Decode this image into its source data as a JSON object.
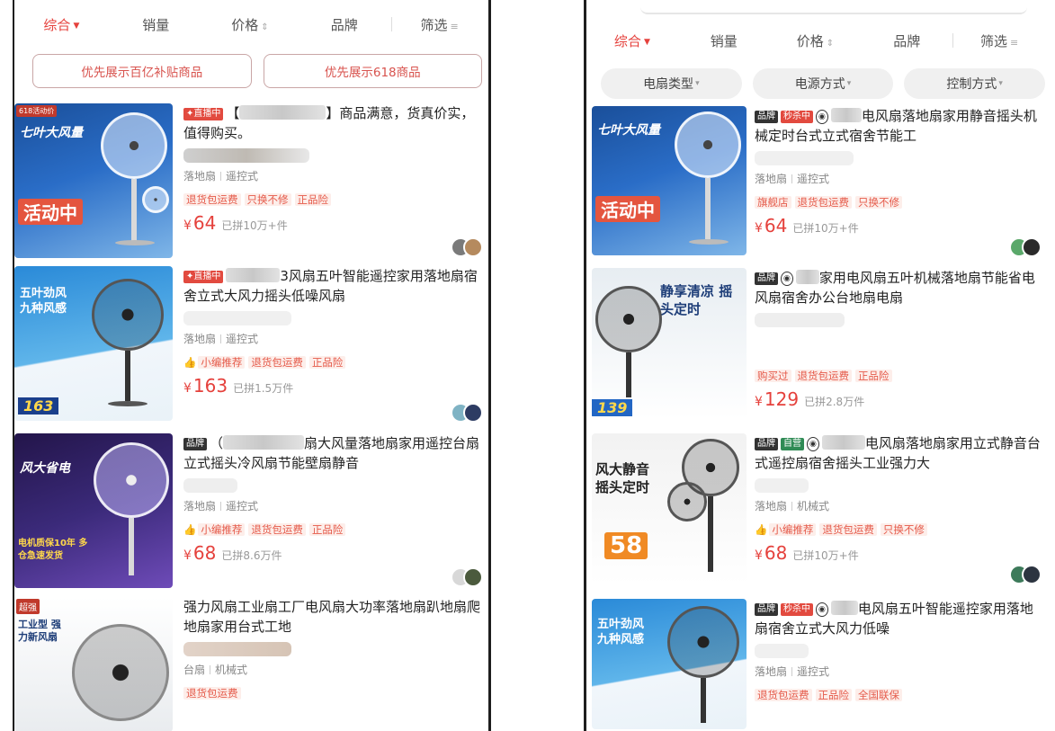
{
  "left": {
    "sort_tabs": [
      {
        "label": "综合",
        "active": true,
        "suffix": "▼"
      },
      {
        "label": "销量",
        "active": false,
        "suffix": ""
      },
      {
        "label": "价格",
        "active": false,
        "suffix": "⇕"
      },
      {
        "label": "品牌",
        "active": false,
        "suffix": ""
      },
      {
        "label": "筛选",
        "active": false,
        "suffix": "≡"
      }
    ],
    "pref_buttons": [
      "优先展示百亿补贴商品",
      "优先展示618商品"
    ],
    "products": [
      {
        "tags": [
          {
            "text": "✦直播中",
            "kind": "red"
          }
        ],
        "title_pre": "【",
        "title_post": "】商品满意，货真价实，值得购买。",
        "specs": [
          "落地扇",
          "遥控式"
        ],
        "services": [
          "退货包运费",
          "只换不修",
          "正品险"
        ],
        "price": "64",
        "sold": "已拼10万+件",
        "image_text": {
          "banner": "七叶大风量",
          "promo": "活动中",
          "corner": "618活动价"
        },
        "avatar_colors": [
          "#7a7a7a",
          "#b58a5e"
        ]
      },
      {
        "tags": [
          {
            "text": "✦直播中",
            "kind": "red"
          }
        ],
        "title_pre": "",
        "title_post": "3风扇五叶智能遥控家用落地扇宿舍立式大风力摇头低噪风扇",
        "specs": [
          "落地扇",
          "遥控式"
        ],
        "services": [
          "小编推荐",
          "退货包运费",
          "正品险"
        ],
        "price": "163",
        "sold": "已拼1.5万件",
        "image_text": {
          "banner": "五叶劲风 九种风感",
          "promo": "163"
        },
        "avatar_colors": [
          "#7fb3c4",
          "#2d3c63"
        ]
      },
      {
        "tags": [
          {
            "text": "品牌",
            "kind": "dark"
          }
        ],
        "title_pre": "（",
        "title_post": "扇大风量落地扇家用遥控台扇立式摇头冷风扇节能壁扇静音",
        "specs": [
          "落地扇",
          "遥控式"
        ],
        "services": [
          "小编推荐",
          "退货包运费",
          "正品险"
        ],
        "price": "68",
        "sold": "已拼8.6万件",
        "image_text": {
          "banner": "风大省电",
          "promo": "电机质保10年 多仓急速发货"
        },
        "avatar_colors": [
          "#d8d8d8",
          "#4b5a3d"
        ]
      },
      {
        "tags": [],
        "title_pre": "",
        "title_post": "强力风扇工业扇工厂电风扇大功率落地扇趴地扇爬地扇家用台式工地",
        "specs": [
          "台扇",
          "机械式"
        ],
        "services": [
          "退货包运费"
        ],
        "price": "",
        "sold": "",
        "image_text": {
          "banner": "工业型 强力新风扇",
          "promo": "超强"
        },
        "avatar_colors": []
      }
    ]
  },
  "right": {
    "sort_tabs": [
      {
        "label": "综合",
        "active": true,
        "suffix": "▼"
      },
      {
        "label": "销量",
        "active": false,
        "suffix": ""
      },
      {
        "label": "价格",
        "active": false,
        "suffix": "⇕"
      },
      {
        "label": "品牌",
        "active": false,
        "suffix": ""
      },
      {
        "label": "筛选",
        "active": false,
        "suffix": "≡"
      }
    ],
    "chips": [
      "电扇类型",
      "电源方式",
      "控制方式"
    ],
    "products": [
      {
        "tags": [
          {
            "text": "品牌",
            "kind": "dark"
          },
          {
            "text": "秒杀中",
            "kind": "red"
          },
          {
            "text": "◉",
            "kind": "circ"
          }
        ],
        "title_pre": "",
        "title_post": "电风扇落地扇家用静音摇头机械定时台式立式宿舍节能工",
        "specs": [
          "落地扇",
          "遥控式"
        ],
        "services": [
          "旗舰店",
          "退货包运费",
          "只换不修"
        ],
        "price": "64",
        "sold": "已拼10万+件",
        "image_text": {
          "banner": "七叶大风量",
          "promo": "活动中"
        },
        "avatar_colors": [
          "#5aa86a",
          "#2a2a2a"
        ]
      },
      {
        "tags": [
          {
            "text": "品牌",
            "kind": "dark"
          },
          {
            "text": "◉",
            "kind": "circ"
          }
        ],
        "title_pre": "",
        "title_post": "家用电风扇五叶机械落地扇节能省电风扇宿舍办公台地扇电扇",
        "specs": [],
        "services": [
          "购买过",
          "退货包运费",
          "正品险"
        ],
        "price": "129",
        "sold": "已拼2.8万件",
        "image_text": {
          "banner": "静享清凉 摇头定时",
          "promo": "139"
        },
        "avatar_colors": []
      },
      {
        "tags": [
          {
            "text": "品牌",
            "kind": "dark"
          },
          {
            "text": "自营",
            "kind": "green"
          },
          {
            "text": "◉",
            "kind": "circ"
          }
        ],
        "title_pre": "",
        "title_post": "电风扇落地扇家用立式静音台式遥控扇宿舍摇头工业强力大",
        "specs": [
          "落地扇",
          "机械式"
        ],
        "services": [
          "小编推荐",
          "退货包运费",
          "只换不修"
        ],
        "price": "68",
        "sold": "已拼10万+件",
        "image_text": {
          "banner": "风大静音 摇头定时",
          "promo": "58"
        },
        "avatar_colors": [
          "#3d7a5a",
          "#2c3440"
        ]
      },
      {
        "tags": [
          {
            "text": "品牌",
            "kind": "dark"
          },
          {
            "text": "秒杀中",
            "kind": "red"
          },
          {
            "text": "◉",
            "kind": "circ"
          }
        ],
        "title_pre": "",
        "title_post": "电风扇五叶智能遥控家用落地扇宿舍立式大风力低噪",
        "specs": [
          "落地扇",
          "遥控式"
        ],
        "services": [
          "退货包运费",
          "正品险",
          "全国联保"
        ],
        "price": "",
        "sold": "",
        "image_text": {
          "banner": "五叶劲风 九种风感",
          "promo": ""
        },
        "avatar_colors": []
      }
    ]
  }
}
